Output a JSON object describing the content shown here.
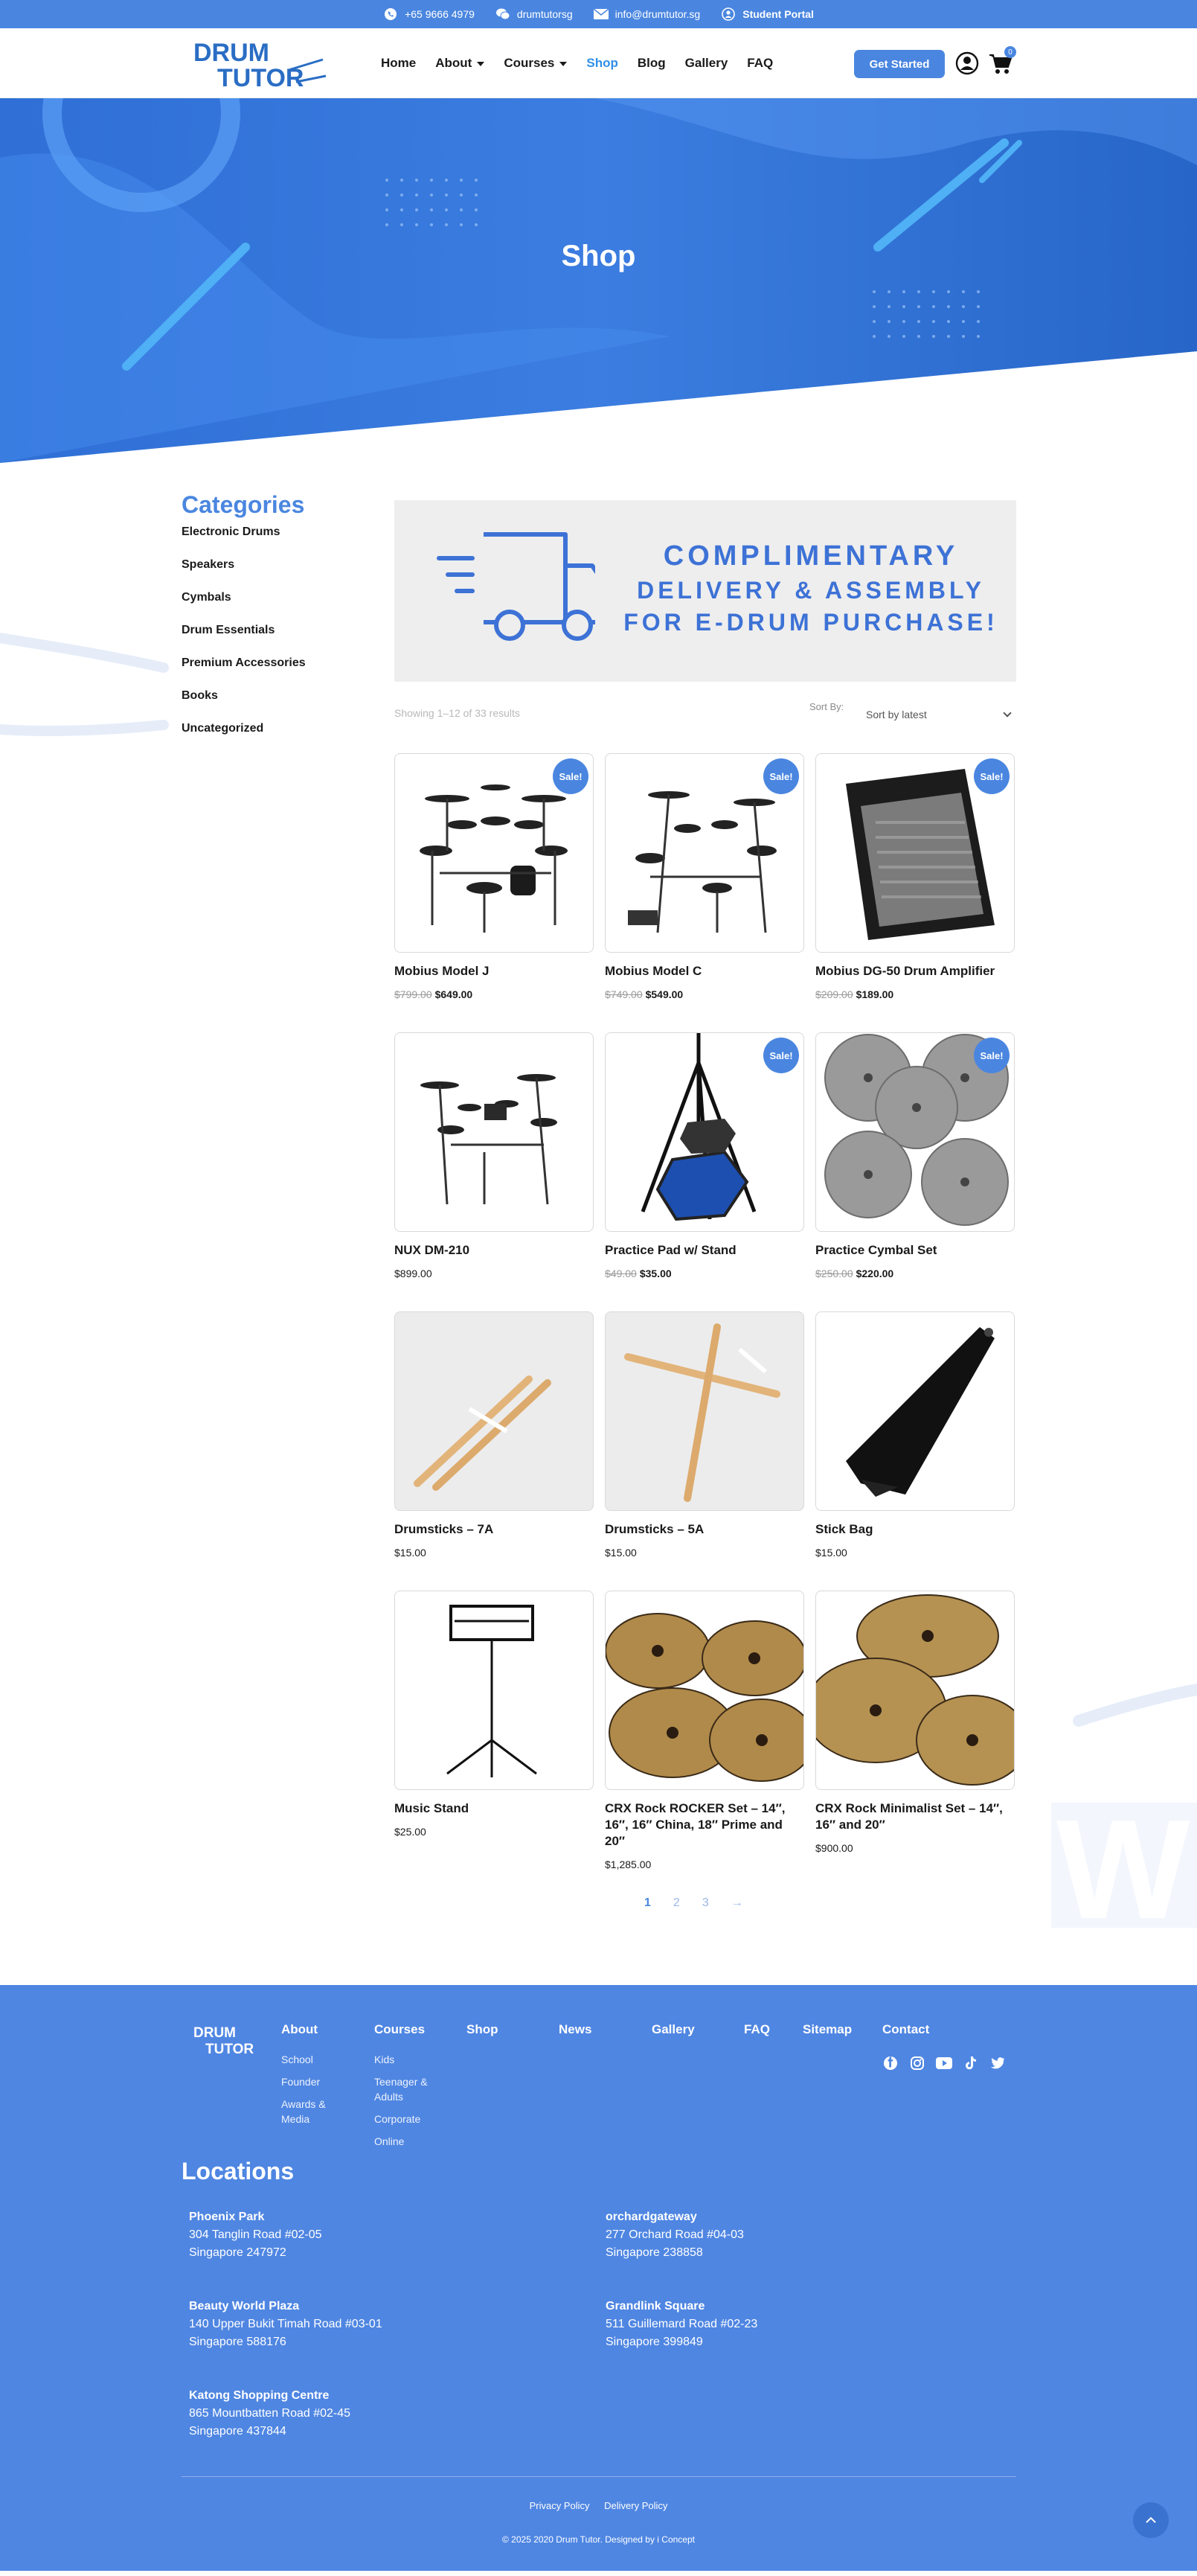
{
  "topbar": {
    "phone": "+65 9666 4979",
    "wechat": "drumtutorsg",
    "email": "info@drumtutor.sg",
    "portal": "Student Portal"
  },
  "header": {
    "logo_line1": "DRUM",
    "logo_line2": "TUTOR",
    "nav": [
      "Home",
      "About",
      "Courses",
      "Shop",
      "Blog",
      "Gallery",
      "FAQ"
    ],
    "cta": "Get Started",
    "cart_count": "0"
  },
  "hero": {
    "title": "Shop"
  },
  "sidebar": {
    "title": "Categories",
    "items": [
      "Electronic Drums",
      "Speakers",
      "Cymbals",
      "Drum Essentials",
      "Premium Accessories",
      "Books",
      "Uncategorized"
    ]
  },
  "banner": {
    "line1": "COMPLIMENTARY",
    "line2": "DELIVERY & ASSEMBLY",
    "line3": "FOR E-DRUM PURCHASE!"
  },
  "results": {
    "showing": "Showing 1–12 of 33 results",
    "sort_label": "Sort By:",
    "sort_value": "Sort by latest"
  },
  "products": [
    {
      "name": "Mobius Model J",
      "old_price": "$799.00",
      "price": "$649.00",
      "sale": "Sale!"
    },
    {
      "name": "Mobius Model C",
      "old_price": "$749.00",
      "price": "$549.00",
      "sale": "Sale!"
    },
    {
      "name": "Mobius DG-50 Drum Amplifier",
      "old_price": "$209.00",
      "price": "$189.00",
      "sale": "Sale!"
    },
    {
      "name": "NUX DM-210",
      "old_price": "",
      "price": "$899.00",
      "sale": ""
    },
    {
      "name": "Practice Pad w/ Stand",
      "old_price": "$49.00",
      "price": "$35.00",
      "sale": "Sale!"
    },
    {
      "name": "Practice Cymbal Set",
      "old_price": "$250.00",
      "price": "$220.00",
      "sale": "Sale!"
    },
    {
      "name": "Drumsticks – 7A",
      "old_price": "",
      "price": "$15.00",
      "sale": ""
    },
    {
      "name": "Drumsticks – 5A",
      "old_price": "",
      "price": "$15.00",
      "sale": ""
    },
    {
      "name": "Stick Bag",
      "old_price": "",
      "price": "$15.00",
      "sale": ""
    },
    {
      "name": "Music Stand",
      "old_price": "",
      "price": "$25.00",
      "sale": ""
    },
    {
      "name": "CRX Rock ROCKER Set – 14″, 16″, 16″ China, 18″ Prime and 20″",
      "old_price": "",
      "price": "$1,285.00",
      "sale": ""
    },
    {
      "name": "CRX Rock Minimalist Set – 14″, 16″ and 20″",
      "old_price": "",
      "price": "$900.00",
      "sale": ""
    }
  ],
  "pagination": [
    "1",
    "2",
    "3",
    "→"
  ],
  "footer": {
    "logo_line1": "DRUM",
    "logo_line2": "TUTOR",
    "columns": [
      {
        "heading": "About",
        "links": [
          "School",
          "Founder",
          "Awards &",
          "Media"
        ]
      },
      {
        "heading": "Courses",
        "links": [
          "Kids",
          "Teenager &",
          "Adults",
          "Corporate",
          "Online"
        ]
      },
      {
        "heading": "Shop",
        "links": []
      },
      {
        "heading": "News",
        "links": []
      },
      {
        "heading": "Gallery",
        "links": []
      },
      {
        "heading": "FAQ",
        "links": []
      },
      {
        "heading": "Sitemap",
        "links": []
      },
      {
        "heading": "Contact",
        "links": []
      }
    ],
    "socials": [
      "facebook-icon",
      "instagram-icon",
      "youtube-icon",
      "tiktok-icon",
      "twitter-icon"
    ],
    "locations_title": "Locations",
    "locations": [
      {
        "name": "Phoenix Park",
        "line1": "304 Tanglin Road #02-05",
        "line2": "Singapore 247972"
      },
      {
        "name": "orchardgateway",
        "line1": "277 Orchard Road #04-03",
        "line2": "Singapore 238858"
      },
      {
        "name": "Beauty World Plaza",
        "line1": "140 Upper Bukit Timah Road #03-01",
        "line2": "Singapore 588176"
      },
      {
        "name": "Grandlink Square",
        "line1": "511 Guillemard Road #02-23",
        "line2": "Singapore 399849"
      },
      {
        "name": "Katong Shopping Centre",
        "line1": "865 Mountbatten Road #02-45",
        "line2": "Singapore 437844"
      }
    ],
    "policy_links": [
      "Privacy Policy",
      "Delivery Policy"
    ],
    "copyright": "© 2025 2020 Drum Tutor. Designed by i Concept"
  },
  "colors": {
    "brand": "#4a86e0",
    "nav_active": "#2f8fe8",
    "footer_bg": "#4f86e2"
  }
}
